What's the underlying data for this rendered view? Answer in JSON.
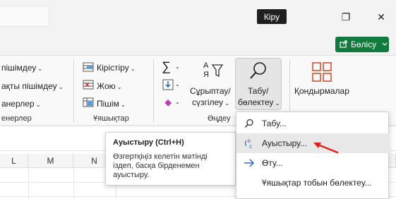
{
  "titlebar": {
    "signin_label": "Кіру",
    "restore_glyph": "❐",
    "close_glyph": "✕",
    "share_label": "Бөлісу",
    "share_icon": "share-icon"
  },
  "ribbon": {
    "format_group": {
      "conditional": "пішімдеу",
      "table": "ақты пішімдеу",
      "styles": "анерлер",
      "label": "енерлер"
    },
    "cells_group": {
      "insert": "Кірістіру",
      "delete": "Жою",
      "format": "Пішім",
      "label": "Ұяшықтар"
    },
    "editing_group": {
      "sort_line1": "Сұрыптау/",
      "sort_line2": "сүзгілеу",
      "find_line1": "Табу/",
      "find_line2": "бөлектеу",
      "label": "Өңдеу",
      "sigma": "∑",
      "az_top": "A",
      "az_bottom": "Я"
    },
    "addins": {
      "label": "Қондырмалар"
    }
  },
  "grid": {
    "columns": [
      "L",
      "M",
      "N"
    ]
  },
  "tooltip": {
    "title": "Ауыстыру (Ctrl+H)",
    "body": "Өзгертқіңіз келетін мәтінді іздеп, басқа бірденемен ауыстыру."
  },
  "find_menu": {
    "items": [
      {
        "label": "Табу...",
        "icon": "search-icon"
      },
      {
        "label": "Ауыстыру...",
        "icon": "replace-icon"
      },
      {
        "label": "Өту...",
        "icon": "arrow-right-icon"
      },
      {
        "label": "Ұяшықтар тобын бөлектеу...",
        "icon": ""
      }
    ]
  },
  "colors": {
    "share_green": "#117a3d",
    "annotation_red": "#e0201b",
    "accent_blue": "#2b6cc4"
  }
}
